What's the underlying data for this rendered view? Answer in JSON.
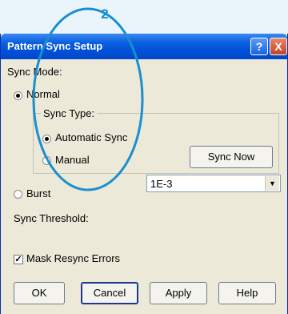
{
  "callout": {
    "number": "2"
  },
  "dialog": {
    "title": "Pattern Sync Setup",
    "help_glyph": "?",
    "close_glyph": "X",
    "sync_mode_label": "Sync Mode:",
    "normal_label": "Normal",
    "sync_type_label": "Sync Type:",
    "automatic_sync_label": "Automatic Sync",
    "manual_label": "Manual",
    "sync_now_label": "Sync Now",
    "burst_label": "Burst",
    "sync_threshold_label": "Sync Threshold:",
    "sync_threshold_value": "1E-3",
    "mask_resync_label": "Mask Resync Errors",
    "mask_resync_checked": true,
    "ok_label": "OK",
    "cancel_label": "Cancel",
    "apply_label": "Apply",
    "help_label": "Help"
  },
  "colors": {
    "callout": "#1a8fd0",
    "titlebar": "#0a5fe0",
    "dialog_bg": "#ece9d8"
  }
}
